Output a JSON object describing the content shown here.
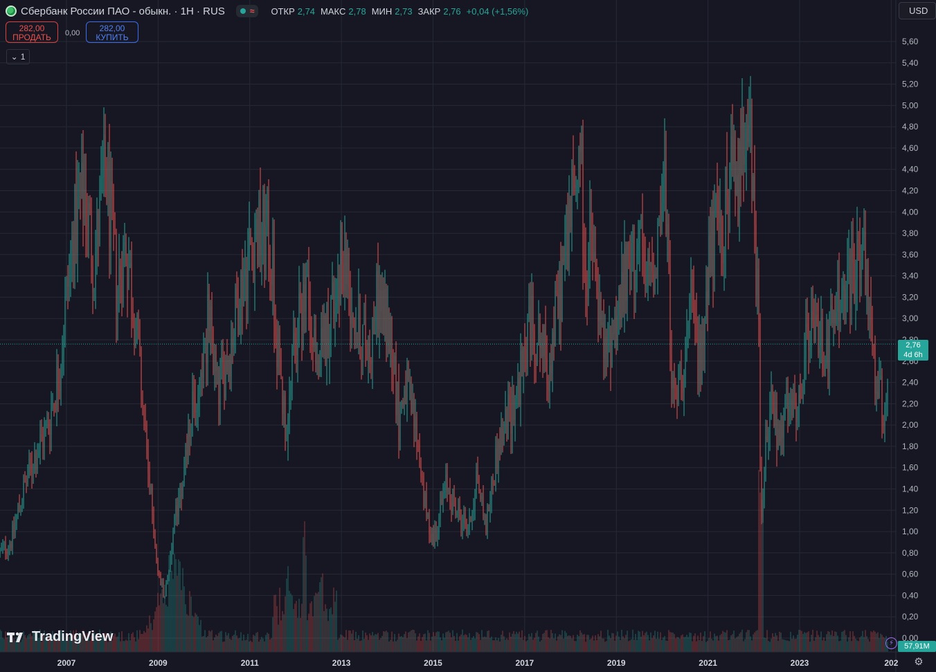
{
  "header": {
    "title": "Сбербанк России ПАО - обыкн. · 1H · RUS",
    "ohlc": [
      {
        "label": "ОТКР",
        "value": "2,74"
      },
      {
        "label": "МАКС",
        "value": "2,78"
      },
      {
        "label": "МИН",
        "value": "2,73"
      },
      {
        "label": "ЗАКР",
        "value": "2,76"
      }
    ],
    "change": "+0,04 (+1,56%)"
  },
  "trade": {
    "sell_price": "282,00",
    "sell_label": "ПРОДАТЬ",
    "spread": "0,00",
    "buy_price": "282,00",
    "buy_label": "КУПИТЬ"
  },
  "collapse_label": "1",
  "currency": "USD",
  "brand": "TradingView",
  "last_price": "2,76",
  "countdown": "4d 6h",
  "volume_label": "57,91M",
  "colors": {
    "up": "#26a69a",
    "down": "#ef5350",
    "background": "#161722",
    "grid": "#262836"
  },
  "chart_data": {
    "type": "candlestick",
    "title": "",
    "xlabel": "",
    "ylabel": "",
    "ylim": [
      0,
      5.7
    ],
    "grid": true,
    "y_ticks": [
      "0,00",
      "0,20",
      "0,40",
      "0,60",
      "0,80",
      "1,00",
      "1,20",
      "1,40",
      "1,60",
      "1,80",
      "2,00",
      "2,20",
      "2,40",
      "2,60",
      "2,80",
      "3,00",
      "3,20",
      "3,40",
      "3,60",
      "3,80",
      "4,00",
      "4,20",
      "4,40",
      "4,60",
      "4,80",
      "5,00",
      "5,20",
      "5,40",
      "5,60"
    ],
    "x_ticks": [
      "2007",
      "2009",
      "2011",
      "2013",
      "2015",
      "2017",
      "2019",
      "2021",
      "2023",
      "202"
    ],
    "x_range": [
      2005.55,
      2025.0
    ],
    "price_path": [
      {
        "x": 2005.55,
        "y": 0.8
      },
      {
        "x": 2005.8,
        "y": 0.92
      },
      {
        "x": 2006.0,
        "y": 1.3
      },
      {
        "x": 2006.3,
        "y": 1.7
      },
      {
        "x": 2006.6,
        "y": 2.0
      },
      {
        "x": 2006.85,
        "y": 2.55
      },
      {
        "x": 2007.0,
        "y": 3.2
      },
      {
        "x": 2007.15,
        "y": 3.8
      },
      {
        "x": 2007.4,
        "y": 4.2
      },
      {
        "x": 2007.6,
        "y": 3.5
      },
      {
        "x": 2007.85,
        "y": 4.4
      },
      {
        "x": 2008.1,
        "y": 3.3
      },
      {
        "x": 2008.3,
        "y": 3.7
      },
      {
        "x": 2008.5,
        "y": 3.0
      },
      {
        "x": 2008.8,
        "y": 1.5
      },
      {
        "x": 2009.0,
        "y": 0.6
      },
      {
        "x": 2009.15,
        "y": 0.4
      },
      {
        "x": 2009.4,
        "y": 1.2
      },
      {
        "x": 2009.7,
        "y": 2.0
      },
      {
        "x": 2009.9,
        "y": 2.4
      },
      {
        "x": 2010.1,
        "y": 3.0
      },
      {
        "x": 2010.3,
        "y": 2.3
      },
      {
        "x": 2010.55,
        "y": 2.7
      },
      {
        "x": 2010.8,
        "y": 3.3
      },
      {
        "x": 2011.1,
        "y": 3.8
      },
      {
        "x": 2011.45,
        "y": 3.7
      },
      {
        "x": 2011.65,
        "y": 2.5
      },
      {
        "x": 2011.8,
        "y": 1.95
      },
      {
        "x": 2012.0,
        "y": 2.8
      },
      {
        "x": 2012.2,
        "y": 3.4
      },
      {
        "x": 2012.45,
        "y": 2.5
      },
      {
        "x": 2012.7,
        "y": 2.95
      },
      {
        "x": 2013.05,
        "y": 3.6
      },
      {
        "x": 2013.3,
        "y": 3.0
      },
      {
        "x": 2013.6,
        "y": 2.7
      },
      {
        "x": 2013.8,
        "y": 3.2
      },
      {
        "x": 2014.1,
        "y": 2.8
      },
      {
        "x": 2014.25,
        "y": 2.05
      },
      {
        "x": 2014.4,
        "y": 2.4
      },
      {
        "x": 2014.65,
        "y": 1.9
      },
      {
        "x": 2014.85,
        "y": 1.15
      },
      {
        "x": 2015.0,
        "y": 0.92
      },
      {
        "x": 2015.3,
        "y": 1.45
      },
      {
        "x": 2015.55,
        "y": 1.15
      },
      {
        "x": 2015.8,
        "y": 1.05
      },
      {
        "x": 2015.95,
        "y": 1.55
      },
      {
        "x": 2016.15,
        "y": 1.05
      },
      {
        "x": 2016.4,
        "y": 1.75
      },
      {
        "x": 2016.7,
        "y": 2.15
      },
      {
        "x": 2016.95,
        "y": 2.5
      },
      {
        "x": 2017.1,
        "y": 2.95
      },
      {
        "x": 2017.35,
        "y": 2.8
      },
      {
        "x": 2017.5,
        "y": 2.5
      },
      {
        "x": 2017.75,
        "y": 3.2
      },
      {
        "x": 2017.95,
        "y": 3.9
      },
      {
        "x": 2018.15,
        "y": 4.3
      },
      {
        "x": 2018.2,
        "y": 4.95
      },
      {
        "x": 2018.3,
        "y": 3.4
      },
      {
        "x": 2018.45,
        "y": 3.7
      },
      {
        "x": 2018.6,
        "y": 3.1
      },
      {
        "x": 2018.75,
        "y": 2.6
      },
      {
        "x": 2019.0,
        "y": 3.05
      },
      {
        "x": 2019.25,
        "y": 3.4
      },
      {
        "x": 2019.5,
        "y": 3.75
      },
      {
        "x": 2019.65,
        "y": 3.25
      },
      {
        "x": 2019.85,
        "y": 3.65
      },
      {
        "x": 2020.05,
        "y": 4.3
      },
      {
        "x": 2020.15,
        "y": 3.2
      },
      {
        "x": 2020.25,
        "y": 2.15
      },
      {
        "x": 2020.5,
        "y": 2.7
      },
      {
        "x": 2020.65,
        "y": 3.1
      },
      {
        "x": 2020.85,
        "y": 2.5
      },
      {
        "x": 2021.0,
        "y": 3.6
      },
      {
        "x": 2021.3,
        "y": 3.85
      },
      {
        "x": 2021.5,
        "y": 4.3
      },
      {
        "x": 2021.7,
        "y": 4.35
      },
      {
        "x": 2021.85,
        "y": 5.35
      },
      {
        "x": 2022.0,
        "y": 3.8
      },
      {
        "x": 2022.1,
        "y": 3.2
      },
      {
        "x": 2022.15,
        "y": 1.15
      },
      {
        "x": 2022.35,
        "y": 2.3
      },
      {
        "x": 2022.55,
        "y": 1.8
      },
      {
        "x": 2022.75,
        "y": 2.2
      },
      {
        "x": 2022.95,
        "y": 2.0
      },
      {
        "x": 2023.15,
        "y": 2.8
      },
      {
        "x": 2023.4,
        "y": 2.9
      },
      {
        "x": 2023.6,
        "y": 2.7
      },
      {
        "x": 2023.8,
        "y": 3.1
      },
      {
        "x": 2024.15,
        "y": 3.35
      },
      {
        "x": 2024.35,
        "y": 3.75
      },
      {
        "x": 2024.5,
        "y": 3.0
      },
      {
        "x": 2024.7,
        "y": 2.35
      },
      {
        "x": 2024.85,
        "y": 2.1
      },
      {
        "x": 2025.0,
        "y": 2.76
      }
    ],
    "volume_spikes": [
      {
        "x": 2009.3,
        "v": 0.55
      },
      {
        "x": 2011.85,
        "v": 0.45
      },
      {
        "x": 2012.2,
        "v": 0.7
      },
      {
        "x": 2012.55,
        "v": 0.65
      },
      {
        "x": 2022.15,
        "v": 1.0
      }
    ],
    "last_close": 2.76
  }
}
